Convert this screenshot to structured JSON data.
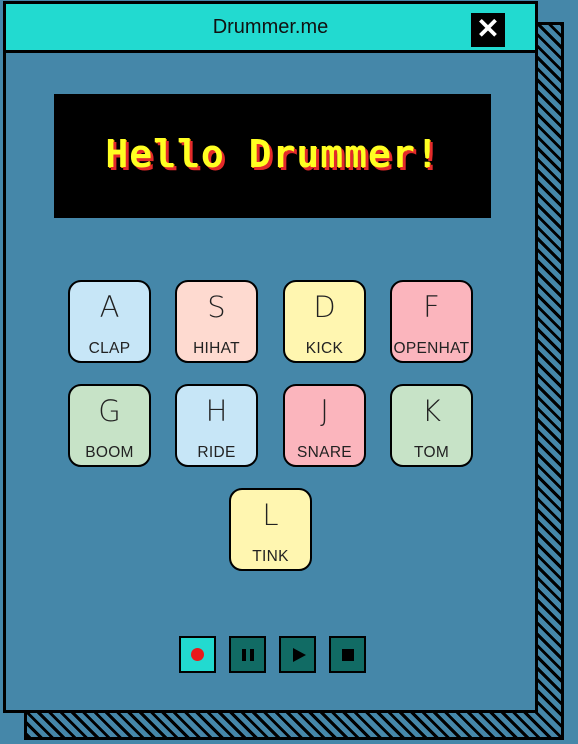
{
  "window": {
    "title": "Drummer.me",
    "close_label": "✕"
  },
  "display": {
    "text": "Hello Drummer!"
  },
  "pads": [
    {
      "key": "A",
      "sound": "CLAP",
      "color": "#c7e6f7"
    },
    {
      "key": "S",
      "sound": "HIHAT",
      "color": "#fedad0"
    },
    {
      "key": "D",
      "sound": "KICK",
      "color": "#fff6b0"
    },
    {
      "key": "F",
      "sound": "OPENHAT",
      "color": "#fbb5bd"
    },
    {
      "key": "G",
      "sound": "BOOM",
      "color": "#c7e3c7"
    },
    {
      "key": "H",
      "sound": "RIDE",
      "color": "#c7e6f7"
    },
    {
      "key": "J",
      "sound": "SNARE",
      "color": "#fbb5bd"
    },
    {
      "key": "K",
      "sound": "TOM",
      "color": "#c7e3c7"
    },
    {
      "key": "L",
      "sound": "TINK",
      "color": "#fff6b0"
    }
  ],
  "controls": {
    "record_icon": "record-icon",
    "pause_icon": "pause-icon",
    "play_icon": "play-icon",
    "stop_icon": "stop-icon"
  },
  "colors": {
    "background": "#4587a9",
    "titlebar": "#22dad0",
    "control": "#116b64",
    "record": "#e81a1a"
  }
}
